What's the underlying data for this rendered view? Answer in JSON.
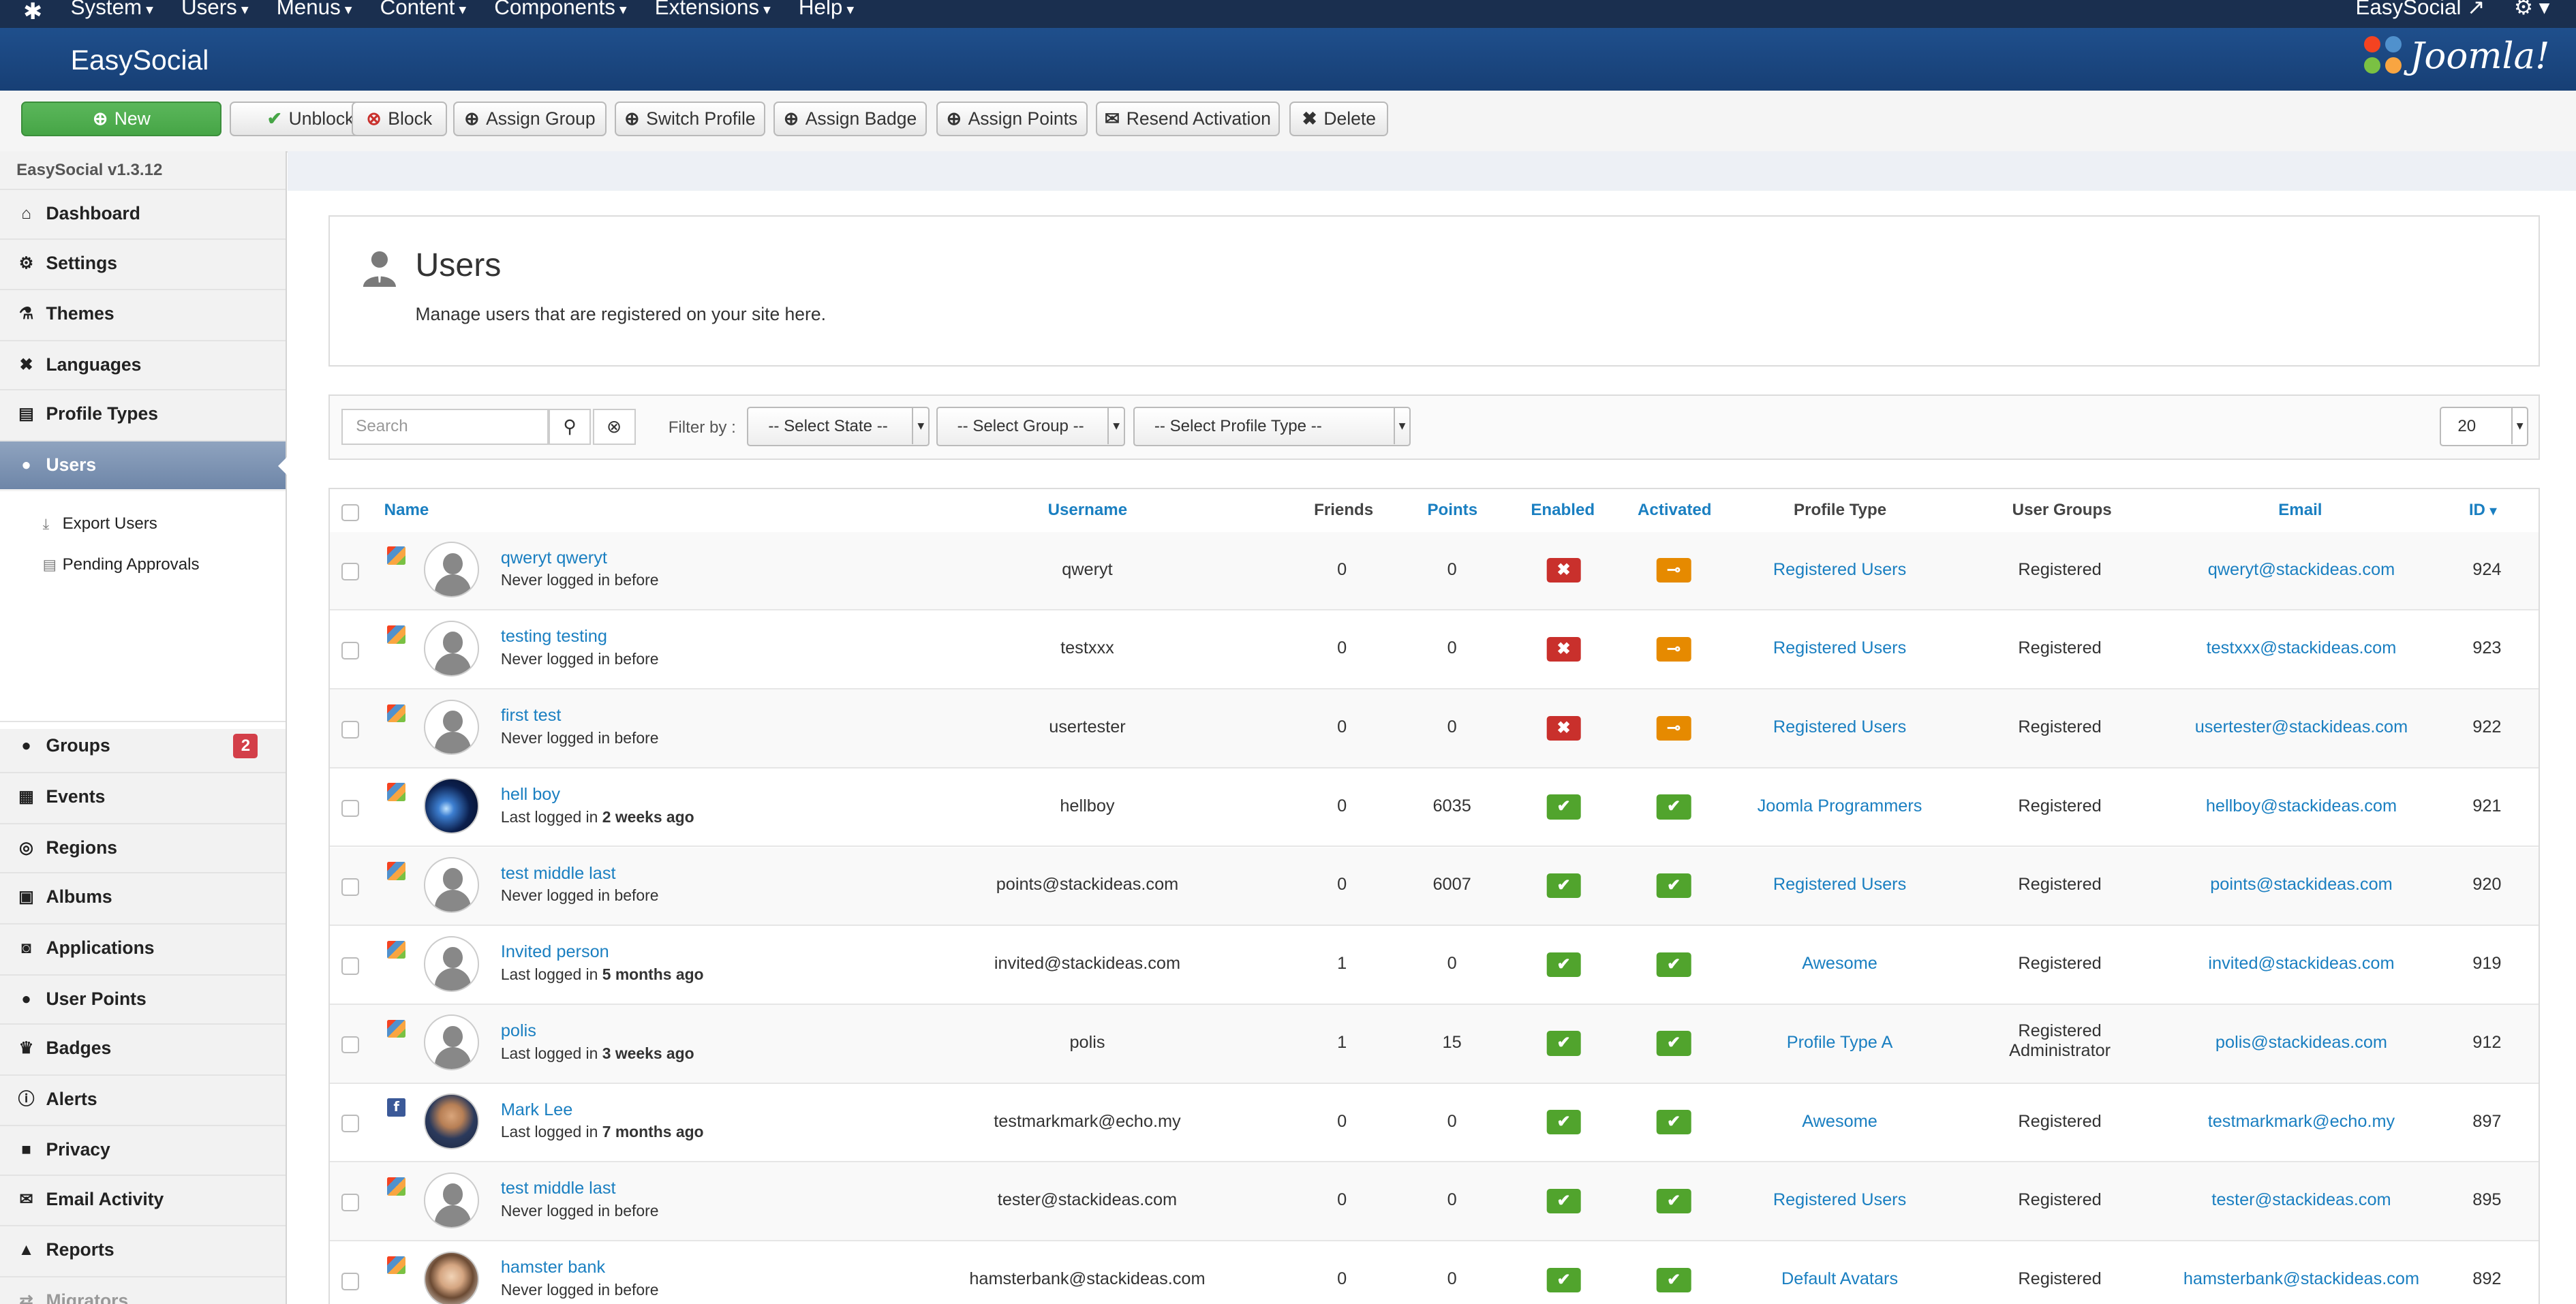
{
  "topnav": {
    "menu": [
      "System",
      "Users",
      "Menus",
      "Content",
      "Components",
      "Extensions",
      "Help"
    ],
    "right_label": "EasySocial ↗"
  },
  "header": {
    "title": "EasySocial",
    "brand": "Joomla!"
  },
  "toolbar": {
    "buttons": [
      {
        "label": "New",
        "icon": "plus-circle-icon"
      },
      {
        "label": "Unblock",
        "icon": "check-icon"
      },
      {
        "label": "Block",
        "icon": "ban-icon"
      },
      {
        "label": "Assign Group",
        "icon": "plus-circle-icon"
      },
      {
        "label": "Switch Profile",
        "icon": "plus-circle-icon"
      },
      {
        "label": "Assign Badge",
        "icon": "plus-circle-icon"
      },
      {
        "label": "Assign Points",
        "icon": "plus-circle-icon"
      },
      {
        "label": "Resend Activation",
        "icon": "envelope-icon"
      },
      {
        "label": "Delete",
        "icon": "times-icon"
      }
    ]
  },
  "sidebar": {
    "version": "EasySocial v1.3.12",
    "items": [
      {
        "label": "Dashboard",
        "icon": "home-icon"
      },
      {
        "label": "Settings",
        "icon": "cog-icon"
      },
      {
        "label": "Themes",
        "icon": "flask-icon"
      },
      {
        "label": "Languages",
        "icon": "puzzle-icon"
      },
      {
        "label": "Profile Types",
        "icon": "id-card-icon"
      },
      {
        "label": "Users",
        "icon": "user-icon"
      }
    ],
    "subitems": [
      {
        "label": "Export Users",
        "icon": "download-icon"
      },
      {
        "label": "Pending Approvals",
        "icon": "list-icon"
      }
    ],
    "lower_items": [
      {
        "label": "Groups",
        "icon": "groups-icon",
        "badge": "2"
      },
      {
        "label": "Events",
        "icon": "calendar-icon"
      },
      {
        "label": "Regions",
        "icon": "globe-icon"
      },
      {
        "label": "Albums",
        "icon": "album-icon"
      },
      {
        "label": "Applications",
        "icon": "apps-icon"
      },
      {
        "label": "User Points",
        "icon": "circle-icon"
      },
      {
        "label": "Badges",
        "icon": "crown-icon"
      },
      {
        "label": "Alerts",
        "icon": "alert-icon"
      },
      {
        "label": "Privacy",
        "icon": "lock-icon"
      },
      {
        "label": "Email Activity",
        "icon": "envelope-icon"
      },
      {
        "label": "Reports",
        "icon": "warning-icon"
      },
      {
        "label": "Migrators",
        "icon": "migrate-icon"
      }
    ]
  },
  "page": {
    "title": "Users",
    "description": "Manage users that are registered on your site here."
  },
  "filters": {
    "search_placeholder": "Search",
    "filter_label": "Filter by :",
    "state": "-- Select State --",
    "group": "-- Select Group --",
    "profile_type": "-- Select Profile Type --",
    "per_page": "20"
  },
  "table": {
    "headers": {
      "name": "Name",
      "username": "Username",
      "friends": "Friends",
      "points": "Points",
      "enabled": "Enabled",
      "activated": "Activated",
      "profile_type": "Profile Type",
      "user_groups": "User Groups",
      "email": "Email",
      "id": "ID"
    },
    "rows": [
      {
        "name": "qweryt qweryt",
        "login_prefix": "Never logged in before",
        "login_bold": "",
        "source": "joomla",
        "avatar": "default",
        "username": "qweryt",
        "friends": "0",
        "points": "0",
        "enabled": false,
        "activated": false,
        "profile": "Registered Users",
        "groups": [
          "Registered"
        ],
        "email": "qweryt@stackideas.com",
        "id": "924"
      },
      {
        "name": "testing testing",
        "login_prefix": "Never logged in before",
        "login_bold": "",
        "source": "joomla",
        "avatar": "default",
        "username": "testxxx",
        "friends": "0",
        "points": "0",
        "enabled": false,
        "activated": false,
        "profile": "Registered Users",
        "groups": [
          "Registered"
        ],
        "email": "testxxx@stackideas.com",
        "id": "923"
      },
      {
        "name": "first test",
        "login_prefix": "Never logged in before",
        "login_bold": "",
        "source": "joomla",
        "avatar": "default",
        "username": "usertester",
        "friends": "0",
        "points": "0",
        "enabled": false,
        "activated": false,
        "profile": "Registered Users",
        "groups": [
          "Registered"
        ],
        "email": "usertester@stackideas.com",
        "id": "922"
      },
      {
        "name": "hell boy",
        "login_prefix": "Last logged in ",
        "login_bold": "2 weeks ago",
        "source": "joomla",
        "avatar": "space",
        "username": "hellboy",
        "friends": "0",
        "points": "6035",
        "enabled": true,
        "activated": true,
        "profile": "Joomla Programmers",
        "groups": [
          "Registered"
        ],
        "email": "hellboy@stackideas.com",
        "id": "921"
      },
      {
        "name": "test middle last",
        "login_prefix": "Never logged in before",
        "login_bold": "",
        "source": "joomla",
        "avatar": "default",
        "username": "points@stackideas.com",
        "friends": "0",
        "points": "6007",
        "enabled": true,
        "activated": true,
        "profile": "Registered Users",
        "groups": [
          "Registered"
        ],
        "email": "points@stackideas.com",
        "id": "920"
      },
      {
        "name": "Invited person",
        "login_prefix": "Last logged in ",
        "login_bold": "5 months ago",
        "source": "joomla",
        "avatar": "default",
        "username": "invited@stackideas.com",
        "friends": "1",
        "points": "0",
        "enabled": true,
        "activated": true,
        "profile": "Awesome",
        "groups": [
          "Registered"
        ],
        "email": "invited@stackideas.com",
        "id": "919"
      },
      {
        "name": "polis",
        "login_prefix": "Last logged in ",
        "login_bold": "3 weeks ago",
        "source": "joomla",
        "avatar": "default",
        "username": "polis",
        "friends": "1",
        "points": "15",
        "enabled": true,
        "activated": true,
        "profile": "Profile Type A",
        "groups": [
          "Registered",
          "Administrator"
        ],
        "email": "polis@stackideas.com",
        "id": "912"
      },
      {
        "name": "Mark Lee",
        "login_prefix": "Last logged in ",
        "login_bold": "7 months ago",
        "source": "facebook",
        "avatar": "mark",
        "username": "testmarkmark@echo.my",
        "friends": "0",
        "points": "0",
        "enabled": true,
        "activated": true,
        "profile": "Awesome",
        "groups": [
          "Registered"
        ],
        "email": "testmarkmark@echo.my",
        "id": "897"
      },
      {
        "name": "test middle last",
        "login_prefix": "Never logged in before",
        "login_bold": "",
        "source": "joomla",
        "avatar": "default",
        "username": "tester@stackideas.com",
        "friends": "0",
        "points": "0",
        "enabled": true,
        "activated": true,
        "profile": "Registered Users",
        "groups": [
          "Registered"
        ],
        "email": "tester@stackideas.com",
        "id": "895"
      },
      {
        "name": "hamster bank",
        "login_prefix": "Never logged in before",
        "login_bold": "",
        "source": "joomla",
        "avatar": "hamster",
        "username": "hamsterbank@stackideas.com",
        "friends": "0",
        "points": "0",
        "enabled": true,
        "activated": true,
        "profile": "Default Avatars",
        "groups": [
          "Registered"
        ],
        "email": "hamsterbank@stackideas.com",
        "id": "892"
      }
    ]
  }
}
